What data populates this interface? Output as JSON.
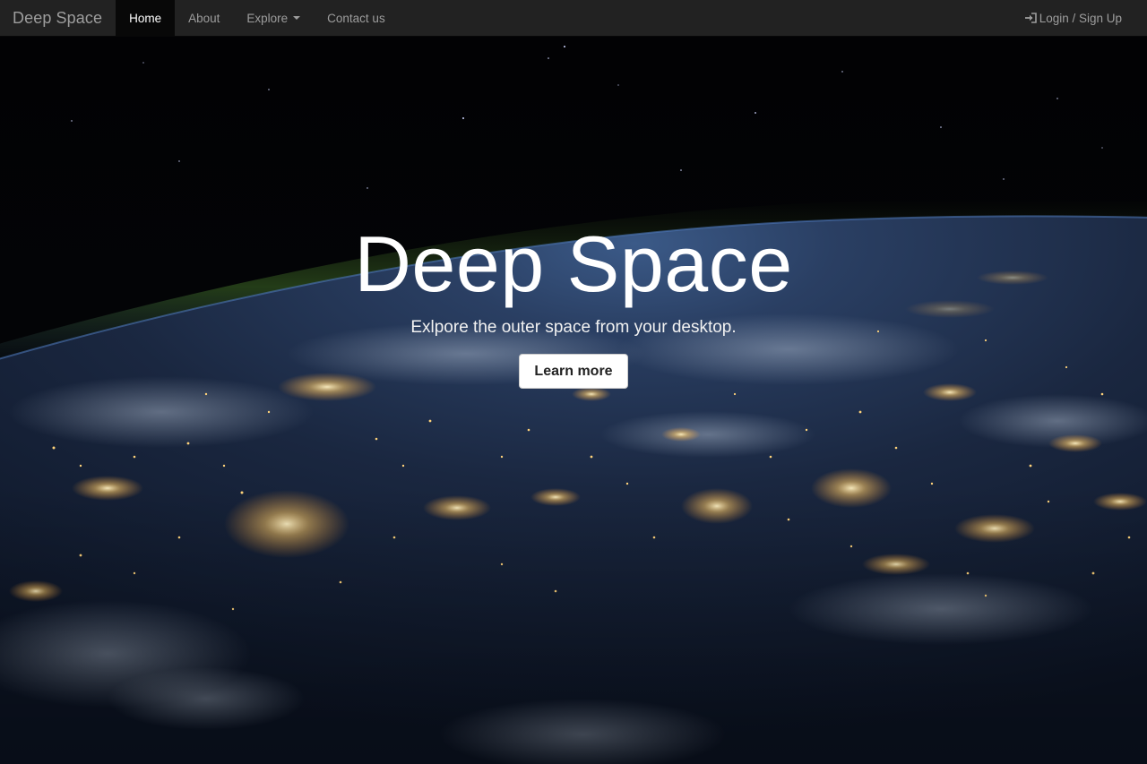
{
  "navbar": {
    "brand": "Deep Space",
    "items": [
      {
        "label": "Home",
        "active": true
      },
      {
        "label": "About",
        "active": false
      },
      {
        "label": "Explore",
        "active": false,
        "dropdown": true
      },
      {
        "label": "Contact us",
        "active": false
      }
    ],
    "login_label": "Login / Sign Up",
    "login_icon": "log-in-icon"
  },
  "hero": {
    "title": "Deep Space",
    "subtitle": "Exlpore the outer space from your desktop.",
    "button_label": "Learn more"
  },
  "colors": {
    "navbar_bg": "#222222",
    "nav_text": "#9d9d9d",
    "nav_active_bg": "#080808",
    "hero_text": "#ffffff",
    "city_lights": "#ffcf6a",
    "ocean": "#1b2a44"
  }
}
